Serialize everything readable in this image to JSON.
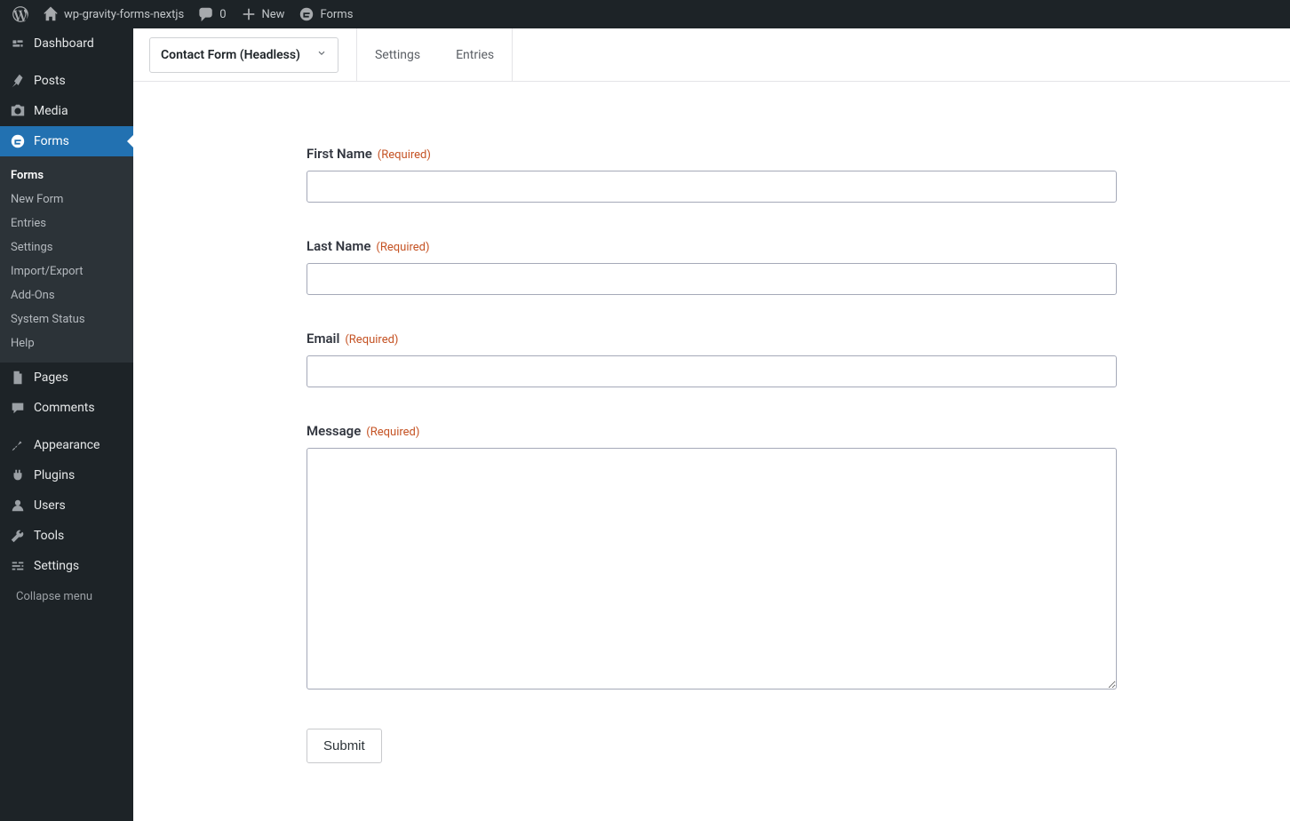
{
  "adminbar": {
    "site_name": "wp-gravity-forms-nextjs",
    "comments_count": "0",
    "new_label": "New",
    "forms_label": "Forms"
  },
  "sidebar": {
    "items": [
      {
        "label": "Dashboard"
      },
      {
        "label": "Posts"
      },
      {
        "label": "Media"
      },
      {
        "label": "Forms"
      },
      {
        "label": "Pages"
      },
      {
        "label": "Comments"
      },
      {
        "label": "Appearance"
      },
      {
        "label": "Plugins"
      },
      {
        "label": "Users"
      },
      {
        "label": "Tools"
      },
      {
        "label": "Settings"
      }
    ],
    "forms_sub": [
      "Forms",
      "New Form",
      "Entries",
      "Settings",
      "Import/Export",
      "Add-Ons",
      "System Status",
      "Help"
    ],
    "collapse_label": "Collapse menu"
  },
  "header": {
    "form_name": "Contact Form (Headless)",
    "tabs": {
      "settings": "Settings",
      "entries": "Entries"
    }
  },
  "form": {
    "required_text": "(Required)",
    "fields": {
      "first_name": {
        "label": "First Name"
      },
      "last_name": {
        "label": "Last Name"
      },
      "email": {
        "label": "Email"
      },
      "message": {
        "label": "Message"
      }
    },
    "submit_label": "Submit"
  }
}
